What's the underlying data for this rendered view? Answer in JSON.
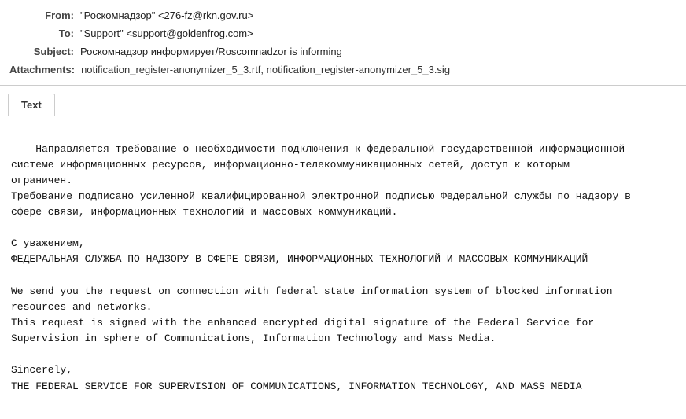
{
  "header": {
    "from_label": "From:",
    "from_value": "\"Роскомнадзор\" <276-fz@rkn.gov.ru>",
    "to_label": "To:",
    "to_value": "\"Support\" <support@goldenfrog.com>",
    "subject_label": "Subject:",
    "subject_value": "Роскомнадзор информирует/Roscomnadzor is informing",
    "attachments_label": "Attachments:",
    "attachments_value": "notification_register-anonymizer_5_3.rtf, notification_register-anonymizer_5_3.sig"
  },
  "tabs": [
    {
      "label": "Text",
      "active": true
    }
  ],
  "body": {
    "text": "Направляется требование о необходимости подключения к федеральной государственной информационной\nсистеме информационных ресурсов, информационно-телекоммуникационных сетей, доступ к которым\nограничен.\nТребование подписано усиленной квалифицированной электронной подписью Федеральной службы по надзору в\nсфере связи, информационных технологий и массовых коммуникаций.\n\nС уважением,\nФЕДЕРАЛЬНАЯ СЛУЖБА ПО НАДЗОРУ В СФЕРЕ СВЯЗИ, ИНФОРМАЦИОННЫХ ТЕХНОЛОГИЙ И МАССОВЫХ КОММУНИКАЦИЙ\n\nWe send you the request on connection with federal state information system of blocked information\nresources and networks.\nThis request is signed with the enhanced encrypted digital signature of the Federal Service for\nSupervision in sphere of Communications, Information Technology and Mass Media.\n\nSincerely,\nTHE FEDERAL SERVICE FOR SUPERVISION OF COMMUNICATIONS, INFORMATION TECHNOLOGY, AND MASS MEDIA"
  }
}
